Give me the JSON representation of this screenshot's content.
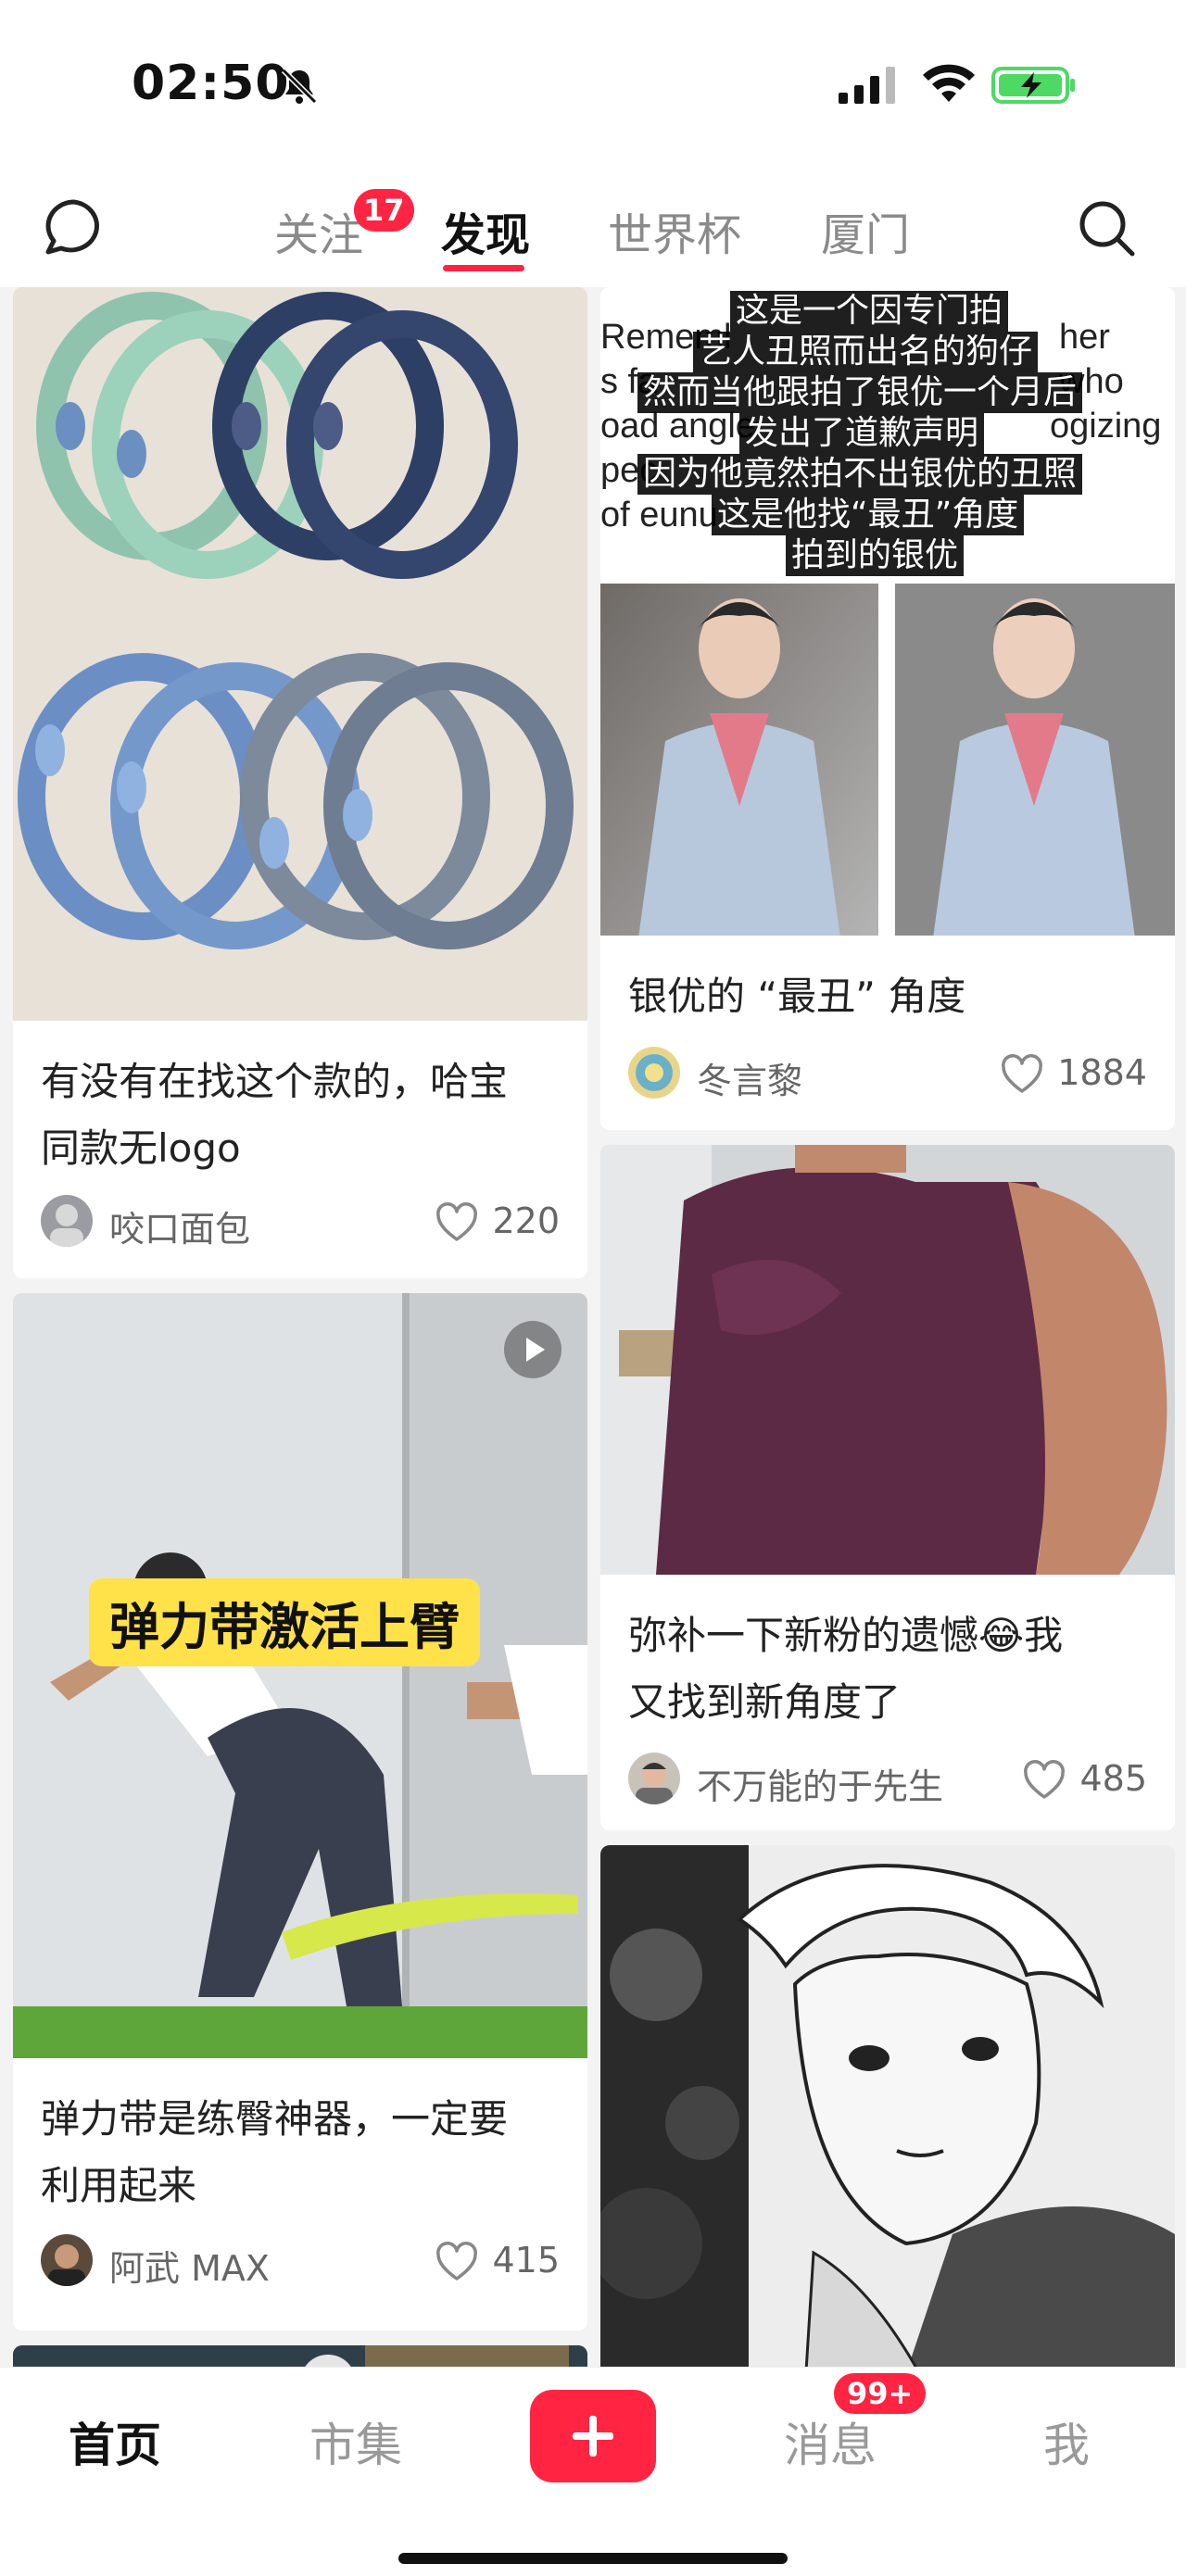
{
  "status_bar": {
    "time": "02:50"
  },
  "top_nav": {
    "tabs": [
      {
        "label": "关注",
        "badge": "17"
      },
      {
        "label": "发现",
        "active": true
      },
      {
        "label": "世界杯"
      },
      {
        "label": "厦门"
      }
    ]
  },
  "feed": {
    "cards": [
      {
        "title_line1": "有没有在找这个款的，哈宝",
        "title_line2": "同款无logo",
        "author": "咬口面包",
        "likes": "220",
        "image": "hair-ties-photo"
      },
      {
        "title": "银优的 “最丑” 角度",
        "author": "冬言黎",
        "likes": "1884",
        "image": "side-by-side-photo",
        "overlay_lines": [
          "这是一个因专门拍",
          "艺人丑照而出名的狗仔",
          "然而当他跟拍了银优一个月后",
          "发出了道歉声明",
          "因为他竟然拍不出银优的丑照",
          "这是他找“最丑”角度",
          "拍到的银优"
        ],
        "bg_text_lines": [
          "Rememl",
          "her who",
          "s fa",
          "oad angle",
          "ogizing",
          "pec",
          "of eunu"
        ]
      },
      {
        "title_line1": "弹力带是练臀神器，一定要",
        "title_line2": "利用起来",
        "author": "阿武 MAX",
        "likes": "415",
        "image": "workout-video",
        "sticker": "弹力带激活上臂"
      },
      {
        "title_line1": "弥补一下新粉的遗憾😂我",
        "title_line2": "又找到新角度了",
        "author": "不万能的于先生",
        "likes": "485",
        "image": "muscle-photo"
      },
      {
        "image": "manga-drawing"
      }
    ]
  },
  "bottom_nav": {
    "items": [
      {
        "label": "首页",
        "active": true
      },
      {
        "label": "市集"
      },
      {
        "label": "消息",
        "badge": "99+"
      },
      {
        "label": "我"
      }
    ]
  },
  "colors": {
    "accent": "#ff2442",
    "background": "#f3f3f3"
  }
}
